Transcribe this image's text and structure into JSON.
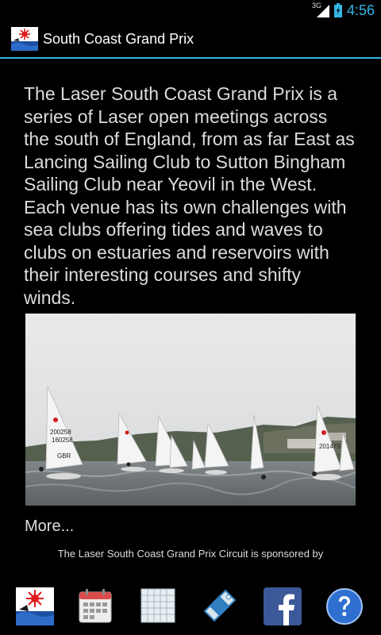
{
  "status_bar": {
    "network": "3G",
    "time": "4:56"
  },
  "app_bar": {
    "title": "South Coast Grand Prix",
    "icon": "club-logo-icon"
  },
  "content": {
    "intro": "The Laser South Coast Grand Prix is a series of Laser open meetings across the south of England, from as far East as Lancing Sailing Club to Sutton Bingham Sailing Club near Yeovil in the West. Each venue has its own challenges with sea clubs offering tides and waves to clubs on estuaries and reservoirs with their interesting courses and shifty winds.",
    "photo": {
      "subject": "laser-dinghies-racing",
      "sail_numbers": [
        "200258",
        "160258",
        "201479"
      ],
      "sail_marks": [
        "GBR"
      ]
    },
    "more_label": "More...",
    "sponsor_text": "The Laser South Coast Grand Prix Circuit is sponsored by"
  },
  "toolbar": {
    "buttons": [
      {
        "icon": "club-logo-icon"
      },
      {
        "icon": "calendar-icon"
      },
      {
        "icon": "schedule-grid-icon"
      },
      {
        "icon": "tag-icon"
      },
      {
        "icon": "facebook-icon"
      },
      {
        "icon": "help-icon"
      }
    ]
  },
  "colors": {
    "accent": "#33b5e5",
    "background": "#000000",
    "text": "#dcdcdc"
  }
}
